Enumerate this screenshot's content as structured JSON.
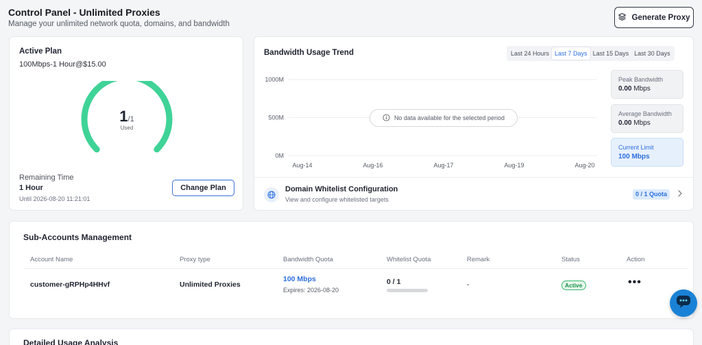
{
  "header": {
    "title": "Control Panel - Unlimited Proxies",
    "subtitle": "Manage your unlimited network quota, domains, and bandwidth",
    "generate_label": "Generate Proxy"
  },
  "plan": {
    "title": "Active Plan",
    "name": "100Mbps-1 Hour@$15.00",
    "used": "1",
    "total": "/1",
    "used_label": "Used",
    "usage_fraction": 1.0,
    "remaining_label": "Remaining Time",
    "remaining_value": "1 Hour",
    "until": "Until 2026-08-20 11:21:01",
    "change_label": "Change Plan",
    "gauge_color": "#3fd398"
  },
  "bandwidth": {
    "title": "Bandwidth Usage Trend",
    "ranges": [
      {
        "label": "Last 24 Hours",
        "active": false
      },
      {
        "label": "Last 7 Days",
        "active": true
      },
      {
        "label": "Last 15 Days",
        "active": false
      },
      {
        "label": "Last 30 Days",
        "active": false
      }
    ],
    "no_data": "No data available for the selected period",
    "stats": {
      "peak_label": "Peak Bandwidth",
      "peak_value": "0.00",
      "peak_unit": "Mbps",
      "avg_label": "Average Bandwidth",
      "avg_value": "0.00",
      "avg_unit": "Mbps",
      "limit_label": "Current Limit",
      "limit_value": "100",
      "limit_unit": "Mbps"
    }
  },
  "chart_data": {
    "type": "line",
    "x": [
      "Aug-14",
      "Aug-16",
      "Aug-17",
      "Aug-19",
      "Aug-20"
    ],
    "series": [],
    "yticks": [
      "0M",
      "500M",
      "1000M"
    ],
    "ylim": [
      0,
      1000
    ],
    "grid": true
  },
  "whitelist": {
    "title": "Domain Whitelist Configuration",
    "subtitle": "View and configure whitelisted targets",
    "quota": "0 / 1 Quota"
  },
  "subaccounts": {
    "title": "Sub-Accounts Management",
    "columns": [
      "Account Name",
      "Proxy type",
      "Bandwidth Quota",
      "Whitelist Quota",
      "Remark",
      "Status",
      "Action"
    ],
    "rows": [
      {
        "account": "customer-gRPHp4HHvf",
        "proxy_type": "Unlimited Proxies",
        "bandwidth": "100 Mbps",
        "expires": "Expires: 2026-08-20",
        "whitelist": "0 / 1",
        "whitelist_fraction": 0,
        "remark": "-",
        "status": "Active",
        "action": "•••"
      }
    ]
  },
  "detail": {
    "title": "Detailed Usage Analysis"
  },
  "colors": {
    "accent": "#2d6fe0",
    "success": "#35b86a",
    "chat": "#1a82d6"
  }
}
